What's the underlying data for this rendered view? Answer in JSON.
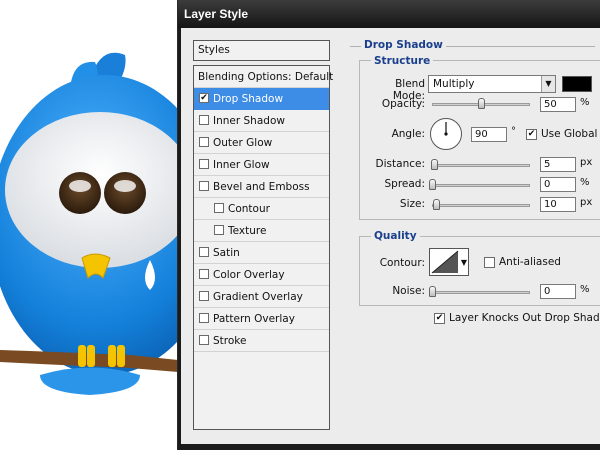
{
  "window": {
    "title": "Layer Style"
  },
  "styles_panel": {
    "header": "Styles",
    "blending_options": "Blending Options: Default",
    "items": [
      {
        "label": "Drop Shadow",
        "checked": true,
        "selected": true,
        "indent": false
      },
      {
        "label": "Inner Shadow",
        "checked": false,
        "selected": false,
        "indent": false
      },
      {
        "label": "Outer Glow",
        "checked": false,
        "selected": false,
        "indent": false
      },
      {
        "label": "Inner Glow",
        "checked": false,
        "selected": false,
        "indent": false
      },
      {
        "label": "Bevel and Emboss",
        "checked": false,
        "selected": false,
        "indent": false
      },
      {
        "label": "Contour",
        "checked": false,
        "selected": false,
        "indent": true
      },
      {
        "label": "Texture",
        "checked": false,
        "selected": false,
        "indent": true
      },
      {
        "label": "Satin",
        "checked": false,
        "selected": false,
        "indent": false
      },
      {
        "label": "Color Overlay",
        "checked": false,
        "selected": false,
        "indent": false
      },
      {
        "label": "Gradient Overlay",
        "checked": false,
        "selected": false,
        "indent": false
      },
      {
        "label": "Pattern Overlay",
        "checked": false,
        "selected": false,
        "indent": false
      },
      {
        "label": "Stroke",
        "checked": false,
        "selected": false,
        "indent": false
      }
    ]
  },
  "drop_shadow": {
    "title": "Drop Shadow",
    "structure": {
      "title": "Structure",
      "blend_mode_label": "Blend Mode:",
      "blend_mode_value": "Multiply",
      "shadow_color": "#000000",
      "opacity_label": "Opacity:",
      "opacity_value": "50",
      "opacity_unit": "%",
      "opacity_level": 0.5,
      "angle_label": "Angle:",
      "angle_value": "90",
      "angle_unit": "°",
      "use_global_light_label": "Use Global Light",
      "use_global_light_checked": true,
      "distance_label": "Distance:",
      "distance_value": "5",
      "distance_unit": "px",
      "distance_level": 0.02,
      "spread_label": "Spread:",
      "spread_value": "0",
      "spread_unit": "%",
      "spread_level": 0.0,
      "size_label": "Size:",
      "size_value": "10",
      "size_unit": "px",
      "size_level": 0.04
    },
    "quality": {
      "title": "Quality",
      "contour_label": "Contour:",
      "anti_aliased_label": "Anti-aliased",
      "anti_aliased_checked": false,
      "noise_label": "Noise:",
      "noise_value": "0",
      "noise_unit": "%",
      "noise_level": 0.0
    },
    "layer_knocks_out_label": "Layer Knocks Out Drop Shadow",
    "layer_knocks_out_checked": true
  },
  "colors": {
    "selection": "#3d8ce6",
    "legend_text": "#1a3f8c",
    "bird_blue": "#1a8be0",
    "beak": "#f5c400"
  }
}
